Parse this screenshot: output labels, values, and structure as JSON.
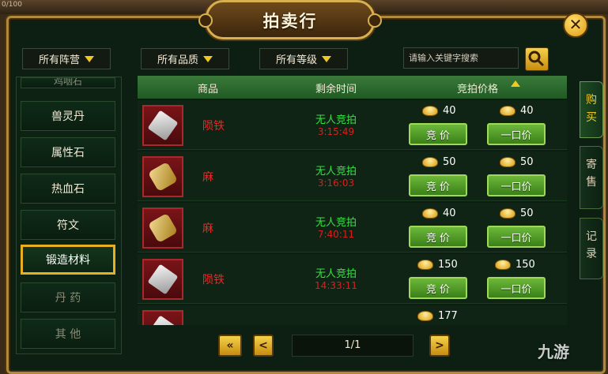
{
  "hud": {
    "hp_text": "0/100"
  },
  "window": {
    "title": "拍卖行",
    "close_icon": "✕"
  },
  "filters": {
    "faction": "所有阵营",
    "quality": "所有品质",
    "level": "所有等级",
    "search_placeholder": "请输入关键字搜索"
  },
  "categories": [
    {
      "label": "鸡咽石",
      "state": "cut"
    },
    {
      "label": "兽灵丹",
      "state": "normal"
    },
    {
      "label": "属性石",
      "state": "normal"
    },
    {
      "label": "热血石",
      "state": "normal"
    },
    {
      "label": "符文",
      "state": "normal"
    },
    {
      "label": "锻造材料",
      "state": "active"
    },
    {
      "label": "丹 药",
      "state": "dim"
    },
    {
      "label": "其 他",
      "state": "dim"
    }
  ],
  "table": {
    "headers": {
      "item": "商品",
      "time": "剩余时间",
      "price": "竞拍价格"
    },
    "rows": [
      {
        "icon": "iron",
        "name": "陨铁",
        "status": "无人竞拍",
        "time": "3:15:49",
        "bid_price": "40",
        "buyout_price": "40"
      },
      {
        "icon": "hemp",
        "name": "麻",
        "status": "无人竞拍",
        "time": "3:16:03",
        "bid_price": "50",
        "buyout_price": "50"
      },
      {
        "icon": "hemp",
        "name": "麻",
        "status": "无人竞拍",
        "time": "7:40:11",
        "bid_price": "40",
        "buyout_price": "50"
      },
      {
        "icon": "iron",
        "name": "陨铁",
        "status": "无人竞拍",
        "time": "14:33:11",
        "bid_price": "150",
        "buyout_price": "150"
      }
    ],
    "partial_row": {
      "bid_price": "177"
    },
    "bid_button": "竞 价",
    "buyout_button": "一口价"
  },
  "pagination": {
    "first": "«",
    "prev": "<",
    "page": "1/1",
    "next": ">"
  },
  "side_tabs": [
    {
      "label": "购\n买",
      "active": true
    },
    {
      "label": "寄\n售",
      "active": false
    },
    {
      "label": "记\n录",
      "active": false
    }
  ],
  "watermark": "九游",
  "colors": {
    "gold_border": "#b08a3c",
    "header_green": "#2e6a30",
    "button_green": "#5aa82e",
    "item_red": "#e82828",
    "status_green": "#3ae048"
  }
}
